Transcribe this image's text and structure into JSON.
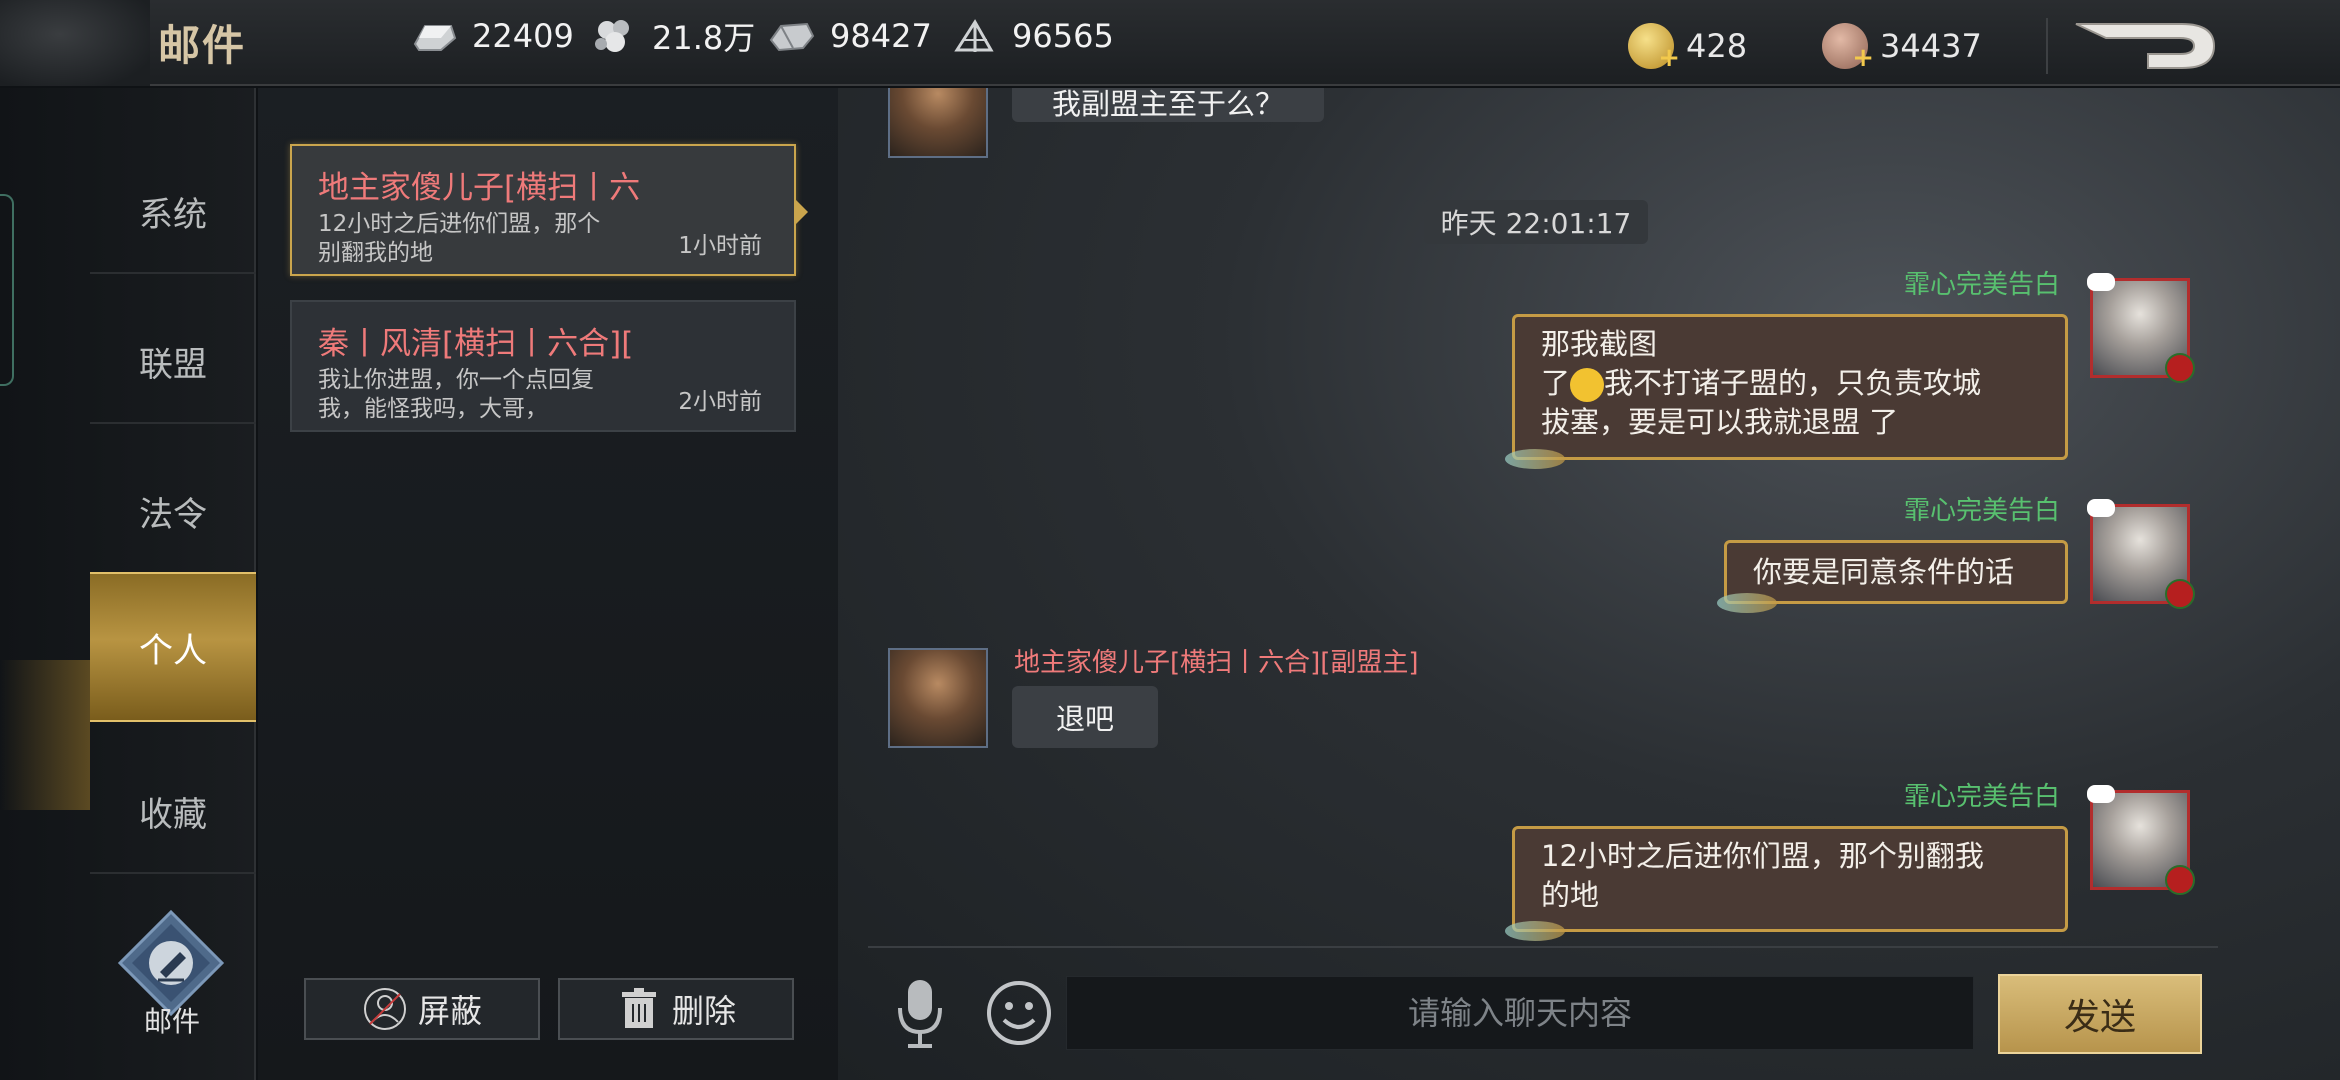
{
  "header": {
    "title": "邮件",
    "resources": [
      {
        "icon": "ingot-icon",
        "value": "22409"
      },
      {
        "icon": "food-icon",
        "value": "21.8万"
      },
      {
        "icon": "ore-icon",
        "value": "98427"
      },
      {
        "icon": "wood-icon",
        "value": "96565"
      }
    ],
    "currencies": [
      {
        "icon": "gold-coin-add-icon",
        "value": "428"
      },
      {
        "icon": "copper-coin-add-icon",
        "value": "34437"
      }
    ]
  },
  "sidebar": {
    "items": [
      {
        "label": "系统"
      },
      {
        "label": "联盟"
      },
      {
        "label": "法令"
      },
      {
        "label": "个人",
        "active": true
      },
      {
        "label": "收藏"
      }
    ],
    "compose_label": "邮件"
  },
  "mail_list": {
    "items": [
      {
        "sender": "地主家傻儿子[横扫丨六",
        "preview": "12小时之后进你们盟，那个别翻我的地",
        "time": "1小时前",
        "selected": true
      },
      {
        "sender": "秦丨风清[横扫丨六合][",
        "preview": "我让你进盟，你一个点回复我，能怪我吗，大哥，",
        "time": "2小时前",
        "selected": false
      }
    ],
    "block_label": "屏蔽",
    "delete_label": "删除"
  },
  "chat": {
    "clipped_message": "我副盟主至于么？",
    "timestamp": "昨天 22:01:17",
    "messages": [
      {
        "from": "me",
        "name": "霏心完美告白",
        "lines": [
          "那我截图",
          "我不打诸子盟的，只负责攻城",
          "拔塞，要是可以我就退盟 了"
        ],
        "line2_prefix": "了"
      },
      {
        "from": "me",
        "name": "霏心完美告白",
        "lines": [
          "你要是同意条件的话"
        ]
      },
      {
        "from": "other",
        "name": "地主家傻儿子[横扫丨六合][副盟主]",
        "lines": [
          "退吧"
        ]
      },
      {
        "from": "me",
        "name": "霏心完美告白",
        "lines": [
          "12小时之后进你们盟，那个别翻我",
          "的地"
        ]
      }
    ],
    "input_placeholder": "请输入聊天内容",
    "send_label": "发送"
  },
  "colors": {
    "accent_gold": "#caa54d",
    "sender_red": "#ef7a7a",
    "self_name_green": "#58c06f"
  }
}
